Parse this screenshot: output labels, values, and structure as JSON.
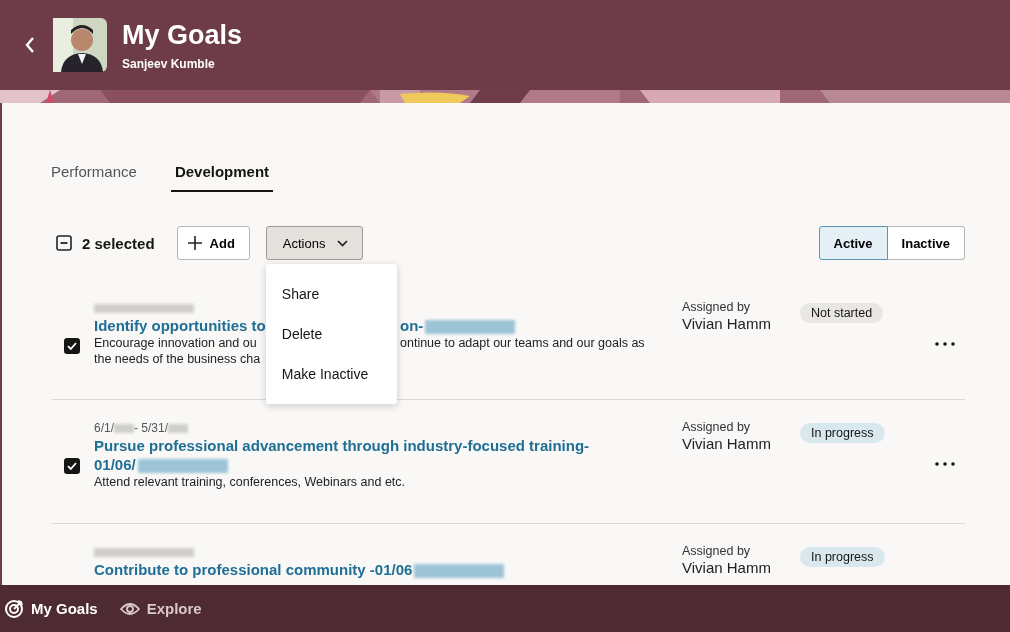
{
  "header": {
    "title": "My Goals",
    "subtitle": "Sanjeev Kumble"
  },
  "tabs": [
    {
      "label": "Performance",
      "selected": false
    },
    {
      "label": "Development",
      "selected": true
    }
  ],
  "toolbar": {
    "selection": "2 selected",
    "add": "Add",
    "actions": "Actions",
    "filters": [
      {
        "label": "Active",
        "selected": true
      },
      {
        "label": "Inactive",
        "selected": false
      }
    ]
  },
  "actions_menu": [
    "Share",
    "Delete",
    "Make Inactive"
  ],
  "goals": [
    {
      "checked": true,
      "date_redacted": true,
      "title_parts": [
        "Identify opportunities to",
        "on-"
      ],
      "title_redacted": true,
      "description_lines": [
        [
          "Encourage innovation and ou",
          "ontinue to adapt our teams and our goals as"
        ],
        [
          "the needs of the business cha"
        ]
      ],
      "assigned_label": "Assigned by",
      "assigned_to": "Vivian Hamm",
      "status": "Not started",
      "kind": "not_started"
    },
    {
      "checked": true,
      "date_parts": [
        "6/1/",
        " - 5/31/"
      ],
      "title_parts": [
        "Pursue professional advancement through industry-focused training-01/06/"
      ],
      "title_redacted": true,
      "description_lines": [
        [
          "Attend relevant training, conferences, Webinars and etc."
        ]
      ],
      "assigned_label": "Assigned by",
      "assigned_to": "Vivian Hamm",
      "status": "In progress",
      "kind": "in_progress"
    },
    {
      "date_redacted": true,
      "title_parts": [
        "Contribute to professional community -01/06"
      ],
      "title_redacted": true,
      "assigned_label": "Assigned by",
      "assigned_to": "Vivian Hamm",
      "status": "In progress",
      "kind": "in_progress"
    }
  ],
  "bottom_nav": [
    {
      "label": "My Goals",
      "selected": true
    },
    {
      "label": "Explore",
      "selected": false
    }
  ]
}
